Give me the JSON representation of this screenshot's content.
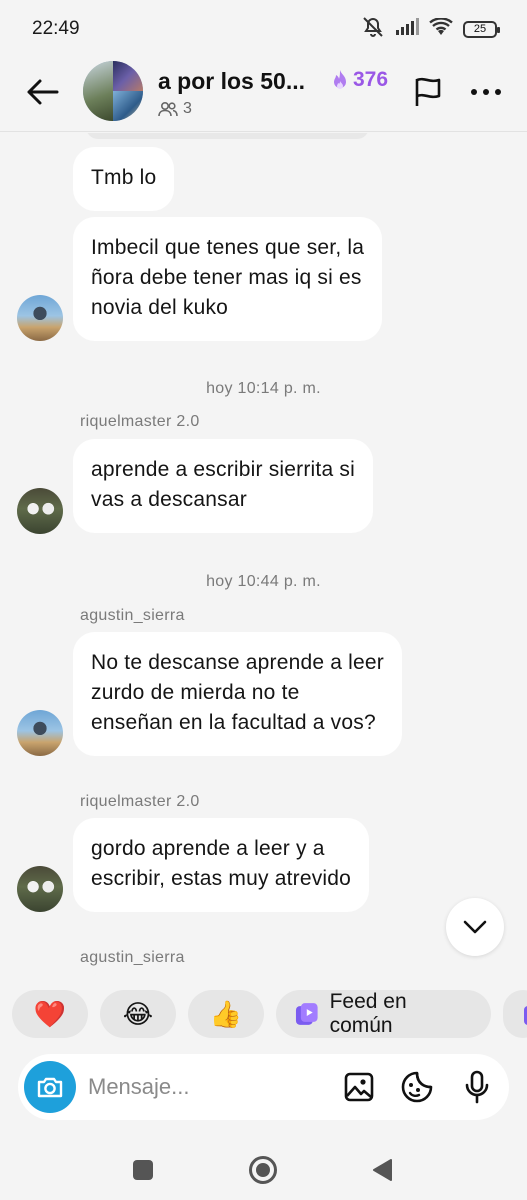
{
  "status_bar": {
    "time": "22:49",
    "battery": "25",
    "icons": [
      "mute-icon",
      "signal-icon",
      "wifi-icon",
      "battery-icon"
    ]
  },
  "header": {
    "title": "a por los 50...",
    "streak_count": "376",
    "member_count": "3",
    "icons": [
      "back-arrow-icon",
      "flame-icon",
      "members-icon",
      "flag-icon",
      "more-icon"
    ]
  },
  "messages": [
    {
      "text": "Tmb lo"
    },
    {
      "text": "Imbecil que tenes que ser, la\nñora debe tener mas iq si es\nnovia del kuko"
    },
    {
      "timestamp": "hoy 10:14 p. m.",
      "sender": "riquelmaster 2.0",
      "text": "aprende a escribir sierrita si\nvas a descansar"
    },
    {
      "timestamp": "hoy 10:44 p. m.",
      "sender": "agustin_sierra",
      "text": "No te descanse aprende a leer\nzurdo de mierda no te\nenseñan en la facultad a vos?"
    },
    {
      "sender": "riquelmaster 2.0",
      "text": "gordo aprende a leer y a\nescribir, estas muy atrevido"
    },
    {
      "sender": "agustin_sierra"
    }
  ],
  "quick_replies": {
    "heart": "❤️",
    "laugh": "😂",
    "thumbs": "👍",
    "feed_label": "Feed en común"
  },
  "composer": {
    "placeholder": "Mensaje..."
  },
  "colors": {
    "accent_purple": "#9a57e6",
    "camera_blue": "#1ea0db",
    "background": "#f4f4f4",
    "bubble": "#ffffff"
  }
}
